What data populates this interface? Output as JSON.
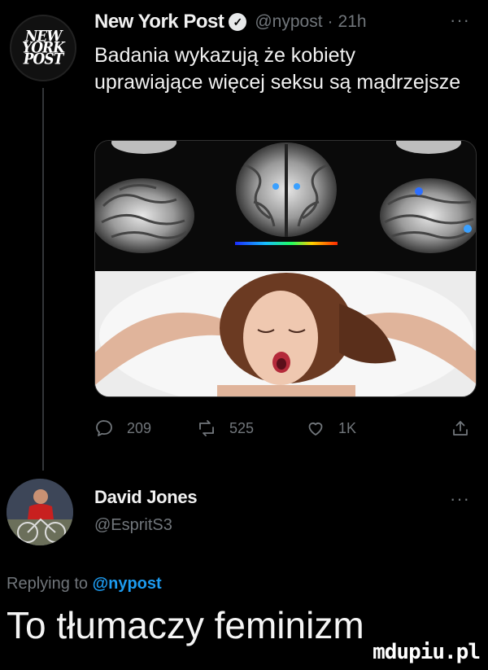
{
  "tweet": {
    "author": {
      "name": "New York Post",
      "handle": "@nypost",
      "avatar_lines": [
        "NEW",
        "YORK",
        "POST"
      ]
    },
    "time": "21h",
    "more": "···",
    "text": "Badania wykazują że kobiety uprawiające więcej seksu są mądrzejsze",
    "stats": {
      "replies": "209",
      "retweets": "525",
      "likes": "1K"
    }
  },
  "reply": {
    "author": {
      "name": "David Jones",
      "handle": "@EspritS3"
    },
    "more": "···",
    "replying_prefix": "Replying to",
    "replying_to": "@nypost",
    "text": "To tłumaczy feminizm"
  },
  "watermark": "mdupiu.pl",
  "icons": {
    "reply": "comment-icon",
    "retweet": "retweet-icon",
    "like": "heart-icon",
    "share": "share-icon",
    "verified": "verified-badge-icon"
  },
  "colors": {
    "background": "#000000",
    "text": "#e7e9ea",
    "muted": "#71767b",
    "link": "#1d9bf0"
  }
}
